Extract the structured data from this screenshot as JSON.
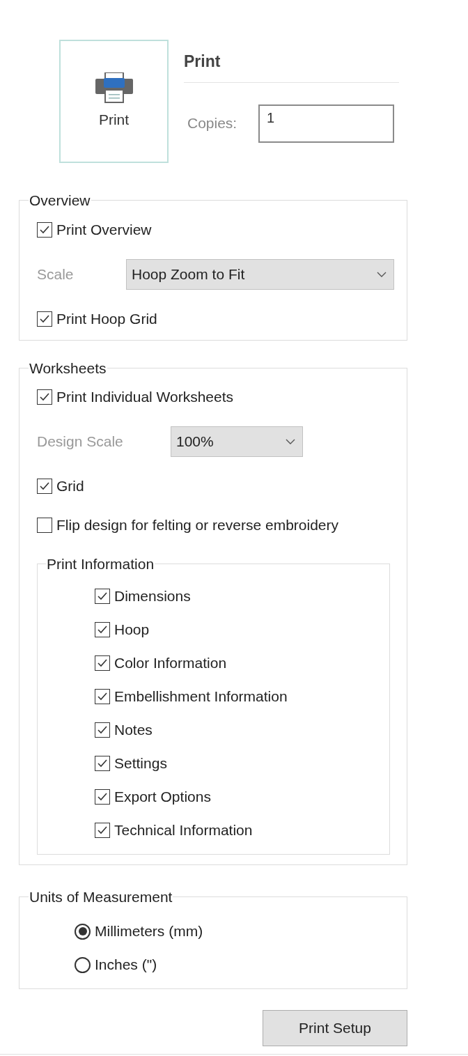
{
  "print_tile": {
    "label": "Print"
  },
  "header": {
    "title": "Print",
    "copies_label": "Copies:",
    "copies_value": "1"
  },
  "overview": {
    "title": "Overview",
    "options": [
      {
        "kind": "checkbox",
        "label": "Print Overview",
        "checked": true
      },
      {
        "kind": "dropdown",
        "label": "Scale",
        "value": "Hoop Zoom to Fit"
      },
      {
        "kind": "checkbox",
        "label": "Print Hoop Grid",
        "checked": true
      }
    ]
  },
  "worksheets": {
    "title": "Worksheets",
    "options": [
      {
        "kind": "checkbox",
        "label": "Print Individual Worksheets",
        "checked": true
      },
      {
        "kind": "dropdown",
        "label": "Design Scale",
        "value": "100%"
      },
      {
        "kind": "checkbox",
        "label": "Grid",
        "checked": true
      },
      {
        "kind": "checkbox",
        "label": "Flip design for felting or reverse embroidery",
        "checked": false
      }
    ],
    "print_information": {
      "title": "Print Information",
      "items": [
        {
          "label": "Dimensions",
          "checked": true
        },
        {
          "label": "Hoop",
          "checked": true
        },
        {
          "label": "Color Information",
          "checked": true
        },
        {
          "label": "Embellishment Information",
          "checked": true
        },
        {
          "label": "Notes",
          "checked": true
        },
        {
          "label": "Settings",
          "checked": true
        },
        {
          "label": "Export Options",
          "checked": true
        },
        {
          "label": "Technical Information",
          "checked": true
        }
      ]
    }
  },
  "units": {
    "title": "Units of Measurement",
    "options": [
      {
        "label": "Millimeters (mm)",
        "selected": true
      },
      {
        "label": "Inches (\")",
        "selected": false
      }
    ]
  },
  "buttons": [
    "Print Setup"
  ]
}
